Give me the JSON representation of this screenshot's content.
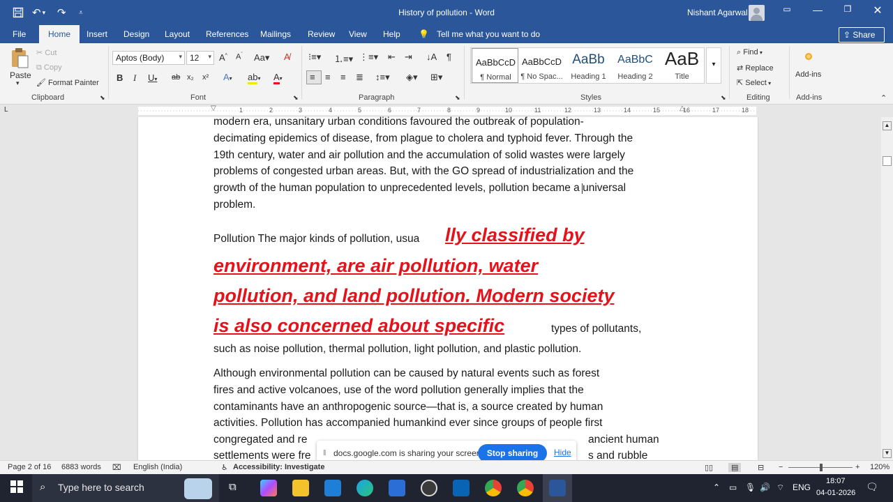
{
  "titlebar": {
    "title": "History of pollution  -  Word",
    "user": "Nishant Agarwal",
    "save_icon": "save-icon",
    "undo_icon": "undo-icon",
    "redo_icon": "redo-icon",
    "accent": "#2b579a"
  },
  "tabs": [
    "File",
    "Home",
    "Insert",
    "Design",
    "Layout",
    "References",
    "Mailings",
    "Review",
    "View",
    "Help"
  ],
  "tell_me": "Tell me what you want to do",
  "share": "Share",
  "ribbon": {
    "clipboard": {
      "paste": "Paste",
      "cut": "Cut",
      "copy": "Copy",
      "format_painter": "Format Painter",
      "label": "Clipboard"
    },
    "font": {
      "name": "Aptos (Body)",
      "size": "12",
      "label": "Font"
    },
    "paragraph": {
      "label": "Paragraph"
    },
    "styles": {
      "items": [
        {
          "preview": "AaBbCcD",
          "name": "¶ Normal"
        },
        {
          "preview": "AaBbCcD",
          "name": "¶ No Spac..."
        },
        {
          "preview": "AaBb",
          "name": "Heading 1"
        },
        {
          "preview": "AaBbC",
          "name": "Heading 2"
        },
        {
          "preview": "AaB",
          "name": "Title"
        }
      ],
      "label": "Styles"
    },
    "editing": {
      "find": "Find",
      "replace": "Replace",
      "select": "Select",
      "label": "Editing"
    },
    "addins": {
      "button": "Add-ins",
      "label": "Add-ins"
    }
  },
  "ruler_ticks": [
    "1",
    "2",
    "3",
    "4",
    "5",
    "6",
    "7",
    "8",
    "9",
    "10",
    "11",
    "12",
    "13",
    "14",
    "15",
    "16",
    "17",
    "18"
  ],
  "document": {
    "para1": [
      "modern era, unsanitary urban conditions favoured the outbreak of population-",
      "decimating epidemics of disease, from plague to cholera and typhoid fever. Through the",
      "19th century, water and air pollution and the accumulation of solid wastes were largely",
      "problems of congested urban areas. But, with the GO spread of industrialization and the",
      "growth of the human population to unprecedented levels, pollution became a universal",
      "problem."
    ],
    "para2_start": "Pollution The major kinds of pollution, usua",
    "para2_red": [
      "lly classified by",
      "environment, are air pollution, water",
      "pollution, and land pollution. Modern society",
      "is also concerned about specific"
    ],
    "para2_tail": " types of pollutants,",
    "para2_end": "such as noise pollution, thermal pollution, light pollution, and plastic pollution.",
    "para3": [
      "Although environmental pollution can be caused by natural events such as forest",
      "fires and active volcanoes, use of the word pollution generally implies that the",
      "contaminants have an anthropogenic source—that is, a source created by human",
      "activities. Pollution has accompanied humankind ever since groups of people first",
      "congregated and re",
      "settlements were fre"
    ],
    "para3_hidden_tail_1": "ancient human",
    "para3_hidden_tail_2": "s and rubble",
    "highlight_color": "#e3121b"
  },
  "share_banner": {
    "message": "docs.google.com is sharing your screen.",
    "stop": "Stop sharing",
    "hide": "Hide"
  },
  "status": {
    "page": "Page 2 of 16",
    "words": "6883 words",
    "language": "English (India)",
    "accessibility": "Accessibility: Investigate",
    "zoom": "120%"
  },
  "taskbar": {
    "search_placeholder": "Type here to search",
    "lang": "ENG",
    "time": "18:07",
    "date": "04-01-2026"
  }
}
